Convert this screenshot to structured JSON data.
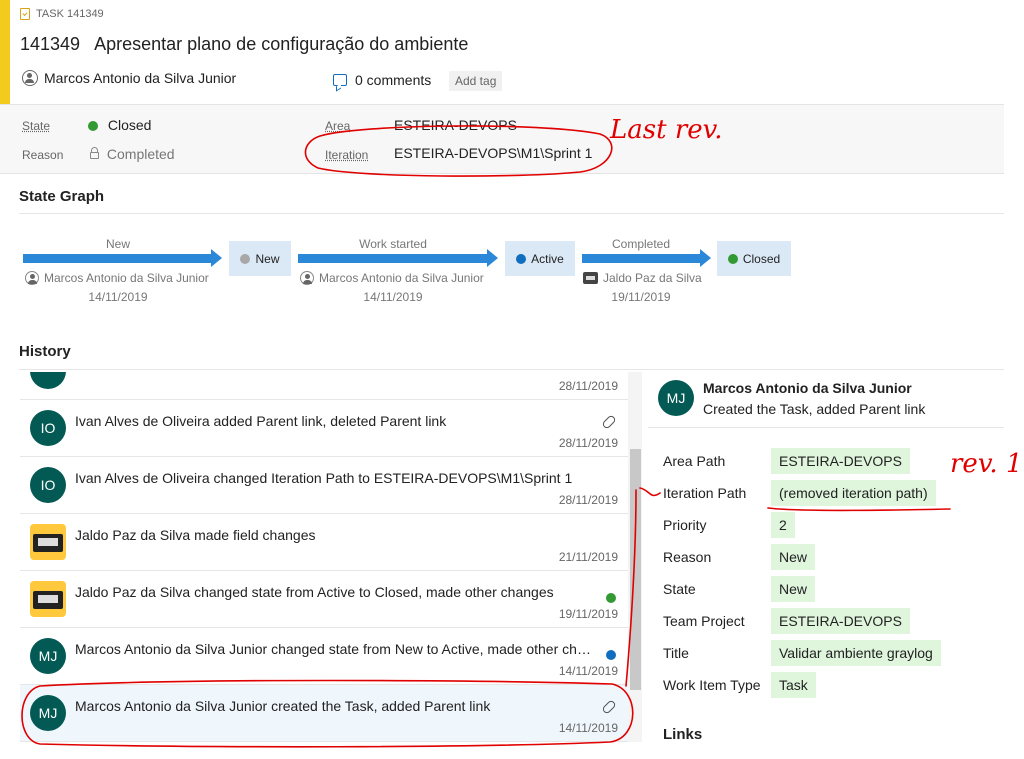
{
  "header": {
    "kind_label": "TASK 141349",
    "id": "141349",
    "title": "Apresentar plano de configuração do ambiente",
    "assignee": "Marcos Antonio da Silva Junior",
    "comments": "0 comments",
    "add_tag": "Add tag",
    "accent_color": "#f2cb1d"
  },
  "fields": {
    "state_label": "State",
    "state_value": "Closed",
    "state_color": "#339933",
    "reason_label": "Reason",
    "reason_value": "Completed",
    "area_label": "Area",
    "area_value": "ESTEIRA-DEVOPS",
    "iteration_label": "Iteration",
    "iteration_value": "ESTEIRA-DEVOPS\\M1\\Sprint 1"
  },
  "state_graph": {
    "title": "State Graph",
    "transitions": [
      {
        "label": "New",
        "user": "Marcos Antonio da Silva Junior",
        "date": "14/11/2019",
        "user_icon": "person-icon"
      },
      {
        "label": "Work started",
        "user": "Marcos Antonio da Silva Junior",
        "date": "14/11/2019",
        "user_icon": "person-icon"
      },
      {
        "label": "Completed",
        "user": "Jaldo Paz da Silva",
        "date": "19/11/2019",
        "user_icon": "badge-icon"
      }
    ],
    "states": [
      {
        "name": "New",
        "color": "#a8a8a8"
      },
      {
        "name": "Active",
        "color": "#106ebe"
      },
      {
        "name": "Closed",
        "color": "#339933"
      }
    ]
  },
  "history": {
    "title": "History",
    "items": [
      {
        "initials": "",
        "text": "",
        "date": "28/11/2019",
        "marker": ""
      },
      {
        "initials": "IO",
        "text": "Ivan Alves de Oliveira added Parent link, deleted Parent link",
        "date": "28/11/2019",
        "marker": "link"
      },
      {
        "initials": "IO",
        "text": "Ivan Alves de Oliveira changed Iteration Path to ESTEIRA-DEVOPS\\M1\\Sprint 1",
        "date": "28/11/2019",
        "marker": ""
      },
      {
        "initials": "",
        "text": "Jaldo Paz da Silva made field changes",
        "date": "21/11/2019",
        "marker": ""
      },
      {
        "initials": "",
        "text": "Jaldo Paz da Silva changed state from Active to Closed, made other changes",
        "date": "19/11/2019",
        "marker": "green"
      },
      {
        "initials": "MJ",
        "text": "Marcos Antonio da Silva Junior changed state from New to Active, made other cha...",
        "date": "14/11/2019",
        "marker": "blue"
      },
      {
        "initials": "MJ",
        "text": "Marcos Antonio da Silva Junior created the Task, added Parent link",
        "date": "14/11/2019",
        "marker": "link"
      }
    ]
  },
  "detail": {
    "initials": "MJ",
    "name": "Marcos Antonio da Silva Junior",
    "summary": "Created the Task, added Parent link",
    "fields": [
      {
        "name": "Area Path",
        "value": "ESTEIRA-DEVOPS"
      },
      {
        "name": "Iteration Path",
        "value": "(removed iteration path)"
      },
      {
        "name": "Priority",
        "value": "2"
      },
      {
        "name": "Reason",
        "value": "New"
      },
      {
        "name": "State",
        "value": "New"
      },
      {
        "name": "Team Project",
        "value": "ESTEIRA-DEVOPS"
      },
      {
        "name": "Title",
        "value": "Validar ambiente graylog"
      },
      {
        "name": "Work Item Type",
        "value": "Task"
      }
    ],
    "links_title": "Links"
  },
  "annotations": {
    "last_rev": "Last rev.",
    "rev1": "rev. 1",
    "color": "#e00000"
  }
}
